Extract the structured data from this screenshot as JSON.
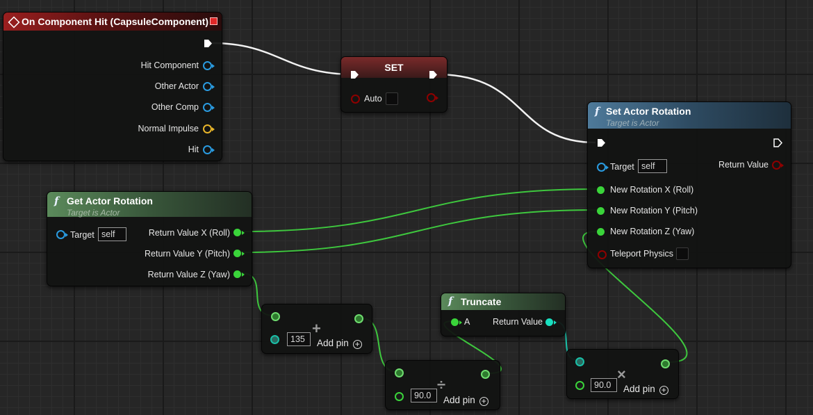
{
  "event_node": {
    "title": "On Component Hit (CapsuleComponent)",
    "pins": [
      "Hit Component",
      "Other Actor",
      "Other Comp",
      "Normal Impulse",
      "Hit"
    ]
  },
  "set_node": {
    "title": "SET",
    "auto_label": "Auto"
  },
  "set_actor_rotation": {
    "title": "Set Actor Rotation",
    "subtitle": "Target is Actor",
    "target_label": "Target",
    "target_value": "self",
    "return_label": "Return Value",
    "inputs": [
      "New Rotation X (Roll)",
      "New Rotation Y (Pitch)",
      "New Rotation Z (Yaw)",
      "Teleport Physics"
    ]
  },
  "get_actor_rotation": {
    "title": "Get Actor Rotation",
    "subtitle": "Target is Actor",
    "target_label": "Target",
    "target_value": "self",
    "outputs": [
      "Return Value X (Roll)",
      "Return Value Y (Pitch)",
      "Return Value Z (Yaw)"
    ]
  },
  "add_node": {
    "operator": "+",
    "value": "135",
    "add_pin": "Add pin"
  },
  "divide_node": {
    "operator": "÷",
    "value": "90.0",
    "add_pin": "Add pin"
  },
  "truncate_node": {
    "title": "Truncate",
    "input_label": "A",
    "return_label": "Return Value"
  },
  "multiply_node": {
    "operator": "×",
    "value": "90.0",
    "add_pin": "Add pin"
  },
  "colors": {
    "exec_wire": "#ffffff",
    "float_wire": "#3ec83e",
    "int_wire": "#19c0a8",
    "event_header": "#9a1f1f",
    "function_header": "#4e7a9a",
    "pure_header": "#5b8a5b"
  }
}
